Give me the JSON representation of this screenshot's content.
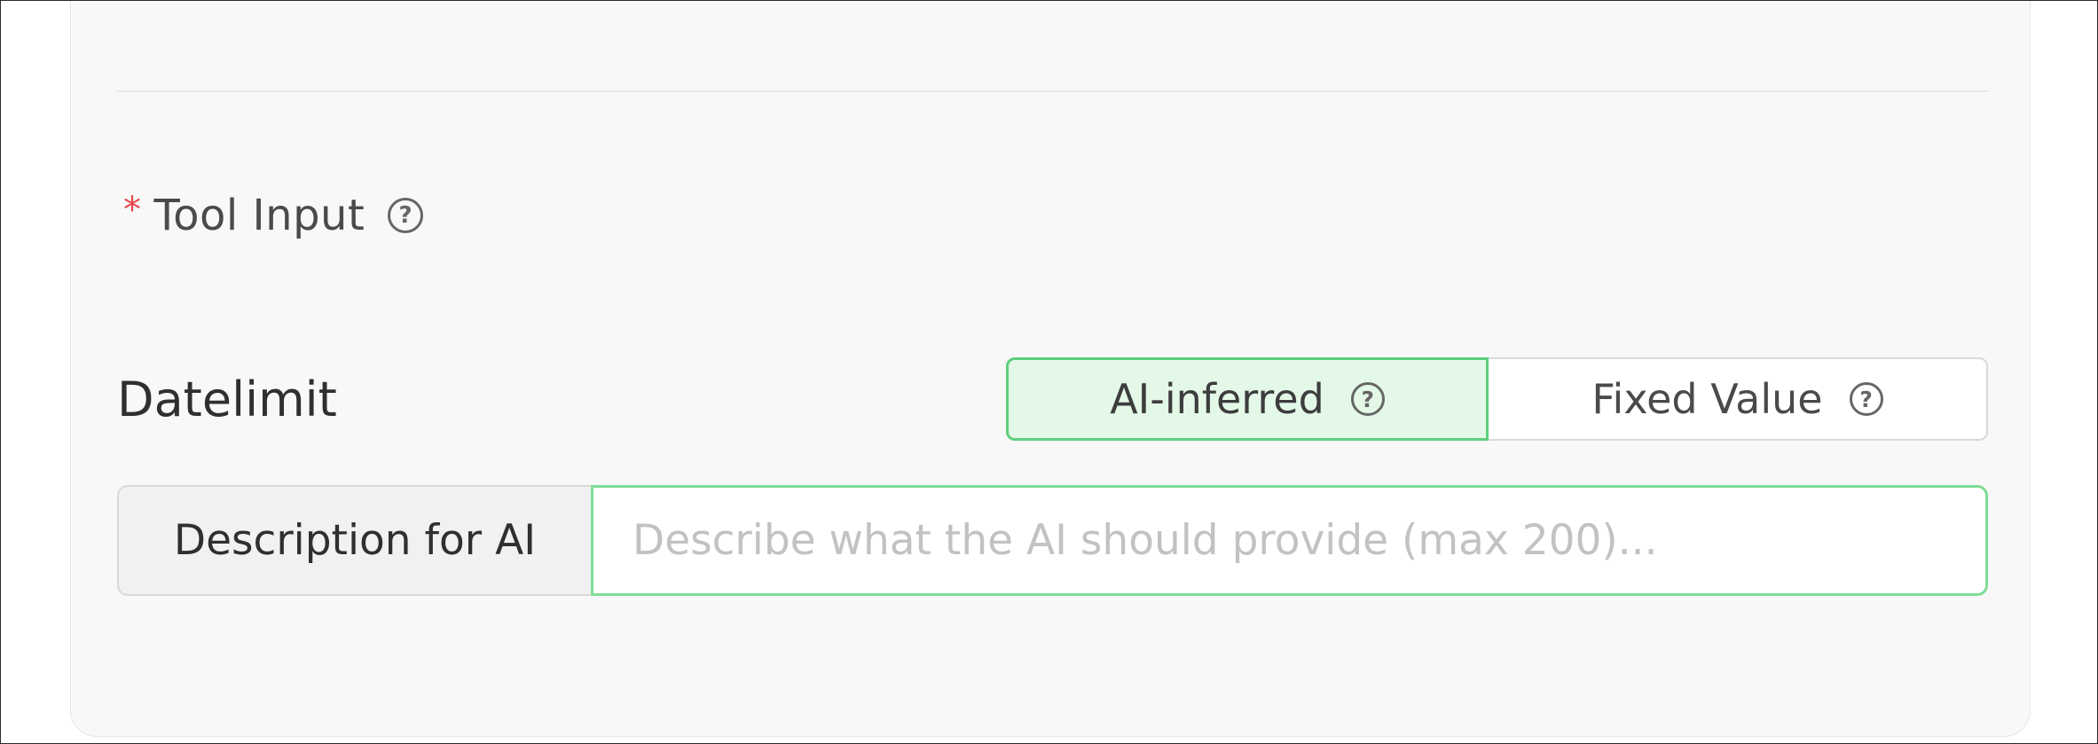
{
  "tool_input": {
    "required_marker": "*",
    "label": "Tool Input",
    "help_icon": "question-circle-icon"
  },
  "parameter": {
    "name": "Datelimit",
    "mode_options": [
      {
        "label": "AI-inferred",
        "selected": true,
        "help_icon": "question-circle-icon"
      },
      {
        "label": "Fixed Value",
        "selected": false,
        "help_icon": "question-circle-icon"
      }
    ],
    "description_label": "Description for AI",
    "description_placeholder": "Describe what the AI should provide (max 200)...",
    "description_value": ""
  },
  "colors": {
    "required": "#e5484d",
    "selected_bg": "#e4f8e8",
    "selected_border": "#5fcf7d",
    "input_focus_border": "#7fdc95"
  }
}
